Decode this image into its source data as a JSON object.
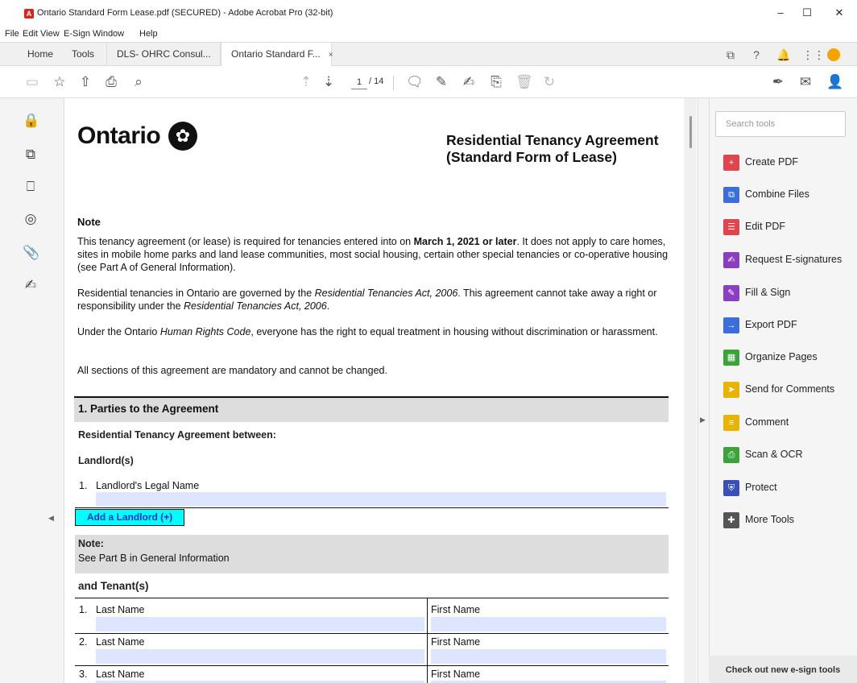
{
  "window": {
    "title": "Ontario Standard Form Lease.pdf (SECURED) - Adobe Acrobat Pro (32-bit)",
    "minimize": "–",
    "maximize": "☐",
    "close": "✕"
  },
  "menu": [
    "File",
    "Edit",
    "View",
    "E-Sign",
    "Window",
    "Help"
  ],
  "tabs": {
    "home": "Home",
    "tools": "Tools",
    "doc1": "DLS- OHRC Consul...",
    "doc2": "Ontario Standard F...",
    "close": "×"
  },
  "toolbar": {
    "page_current": "1",
    "page_total": "/ 14"
  },
  "tools_panel": {
    "search_placeholder": "Search tools",
    "items": [
      {
        "label": "Create PDF",
        "color": "#e0444c"
      },
      {
        "label": "Combine Files",
        "color": "#3a6ed8"
      },
      {
        "label": "Edit PDF",
        "color": "#e0444c"
      },
      {
        "label": "Request E-signatures",
        "color": "#8a3fc1"
      },
      {
        "label": "Fill & Sign",
        "color": "#8a3fc1"
      },
      {
        "label": "Export PDF",
        "color": "#3a6ed8"
      },
      {
        "label": "Organize Pages",
        "color": "#3aa33a"
      },
      {
        "label": "Send for Comments",
        "color": "#e8b400"
      },
      {
        "label": "Comment",
        "color": "#e8b400"
      },
      {
        "label": "Scan & OCR",
        "color": "#3aa33a"
      },
      {
        "label": "Protect",
        "color": "#3a4fb8"
      },
      {
        "label": "More Tools",
        "color": "#555555"
      }
    ],
    "banner": "Check out new e-sign tools"
  },
  "document": {
    "brand": "Ontario",
    "title_line1": "Residential Tenancy Agreement",
    "title_line2": "(Standard Form of Lease)",
    "note_heading": "Note",
    "p1_a": "This tenancy agreement (or lease) is required for tenancies entered into on ",
    "p1_bold": "March 1, 2021 or later",
    "p1_b": ". It does not apply to care homes, sites in mobile home parks and land lease communities, most social housing, certain other special tenancies or co-operative housing (see Part A of General Information).",
    "p2_a": "Residential tenancies in Ontario are governed by the ",
    "p2_i1": "Residential Tenancies Act, 2006",
    "p2_b": ". This agreement cannot take away a right or responsibility under the ",
    "p2_i2": "Residential Tenancies Act, 2006",
    "p2_c": ".",
    "p3_a": "Under the Ontario ",
    "p3_i": "Human Rights Code",
    "p3_b": ", everyone has the right to equal treatment in housing without discrimination or harassment.",
    "p4": "All sections of this agreement are mandatory and cannot be changed.",
    "section1_title": "1. Parties to the Agreement",
    "between": "Residential Tenancy Agreement between:",
    "landlords_heading": "Landlord(s)",
    "landlord_num": "1.",
    "landlord_label": "Landlord's Legal Name",
    "add_landlord": "Add a Landlord (+)",
    "note2_heading": "Note:",
    "note2_text": "See Part B in General Information",
    "tenants_heading": "and Tenant(s)",
    "tenants": [
      {
        "num": "1.",
        "last": "Last Name",
        "first": "First Name"
      },
      {
        "num": "2.",
        "last": "Last Name",
        "first": "First Name"
      },
      {
        "num": "3.",
        "last": "Last Name",
        "first": "First Name"
      }
    ]
  }
}
